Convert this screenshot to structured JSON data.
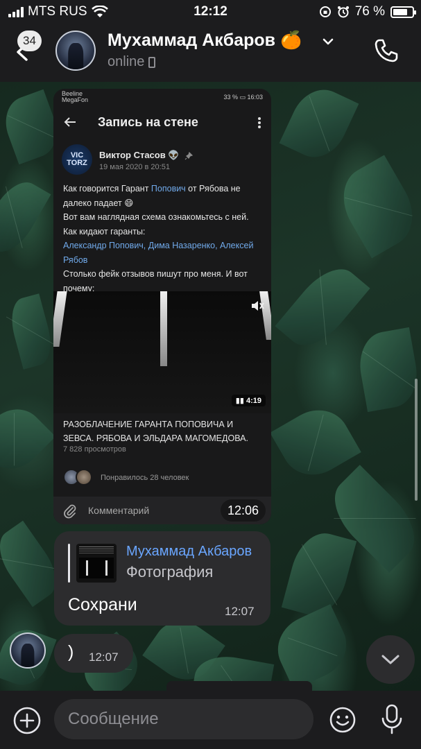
{
  "status_bar": {
    "carrier": "MTS RUS",
    "time": "12:12",
    "battery": "76 %",
    "battery_level": 0.76
  },
  "header": {
    "unread_count": "34",
    "contact_name": "Мухаммад Акбаров 🍊",
    "status": "online"
  },
  "screenshot": {
    "status": {
      "carrier_line1": "Beeline",
      "carrier_line2": "MegaFon",
      "right": "33 % ▭ 16:03"
    },
    "page_title": "Запись на стене",
    "post": {
      "avatar_text_line1": "VIC",
      "avatar_text_line2": "TORZ",
      "author": "Виктор Стасов 👽",
      "date": "19 мая 2020 в 20:51",
      "text_before_link": "Как говорится Гарант ",
      "text_link": "Попович",
      "text_after_link": " от Рябова не далеко падает 😄",
      "line2": "Вот вам наглядная схема ознакомьтесь с ней.",
      "line3": "Как кидают гаранты:",
      "mentions": "Александр Попович, Дима Назаренко, Алексей Рябов",
      "line5": "Столько фейк отзывов пишут про меня. И вот почему:"
    },
    "video": {
      "duration": "4:19",
      "title": "РАЗОБЛАЧЕНИЕ ГАРАНТА ПОПОВИЧА И ЗЕВСА. РЯБОВА И ЭЛЬДАРА МАГОМЕДОВА.",
      "views": "7 828 просмотров"
    },
    "likes": "Понравилось 28 человек",
    "comment_placeholder": "Комментарий",
    "message_time": "12:06"
  },
  "messages": [
    {
      "reply_name": "Мухаммад Акбаров",
      "reply_type": "Фотография",
      "text": "Сохрани",
      "time": "12:07"
    },
    {
      "text": ")",
      "time": "12:07"
    }
  ],
  "input": {
    "placeholder": "Сообщение"
  },
  "icons": {
    "back": "chevron-left-icon",
    "expand": "chevron-down-icon",
    "call": "phone-icon",
    "attach": "plus-icon",
    "emoji": "emoji-icon",
    "voice": "mic-icon",
    "scroll": "chevron-down-icon"
  },
  "colors": {
    "link": "#71aaeb",
    "reply_name": "#6aa6ff",
    "bubble": "#2c2c2e",
    "bar": "#1c1c1e"
  }
}
